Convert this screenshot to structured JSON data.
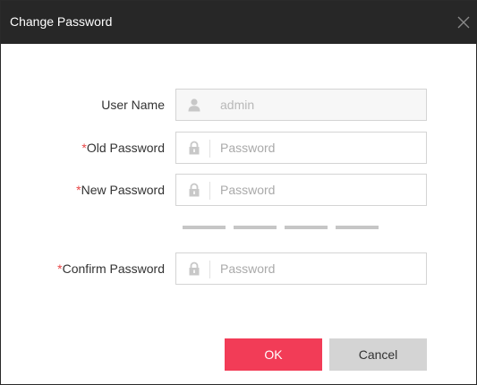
{
  "dialog": {
    "title": "Change Password",
    "close_icon": "close-icon"
  },
  "fields": {
    "username": {
      "label": "User Name",
      "icon": "user-icon",
      "value": "admin",
      "disabled": true
    },
    "old_password": {
      "required_mark": "*",
      "label": "Old Password",
      "icon": "lock-icon",
      "placeholder": "Password"
    },
    "new_password": {
      "required_mark": "*",
      "label": "New Password",
      "icon": "lock-icon",
      "placeholder": "Password"
    },
    "confirm_password": {
      "required_mark": "*",
      "label": "Confirm Password",
      "icon": "lock-icon",
      "placeholder": "Password"
    }
  },
  "strength_meter": {
    "segments": 4,
    "filled": 0,
    "empty_color": "#c6c6c6"
  },
  "buttons": {
    "ok": "OK",
    "cancel": "Cancel"
  },
  "colors": {
    "titlebar": "#272727",
    "primary": "#f23c57",
    "required": "#e84545",
    "secondary_button": "#d4d4d4"
  }
}
